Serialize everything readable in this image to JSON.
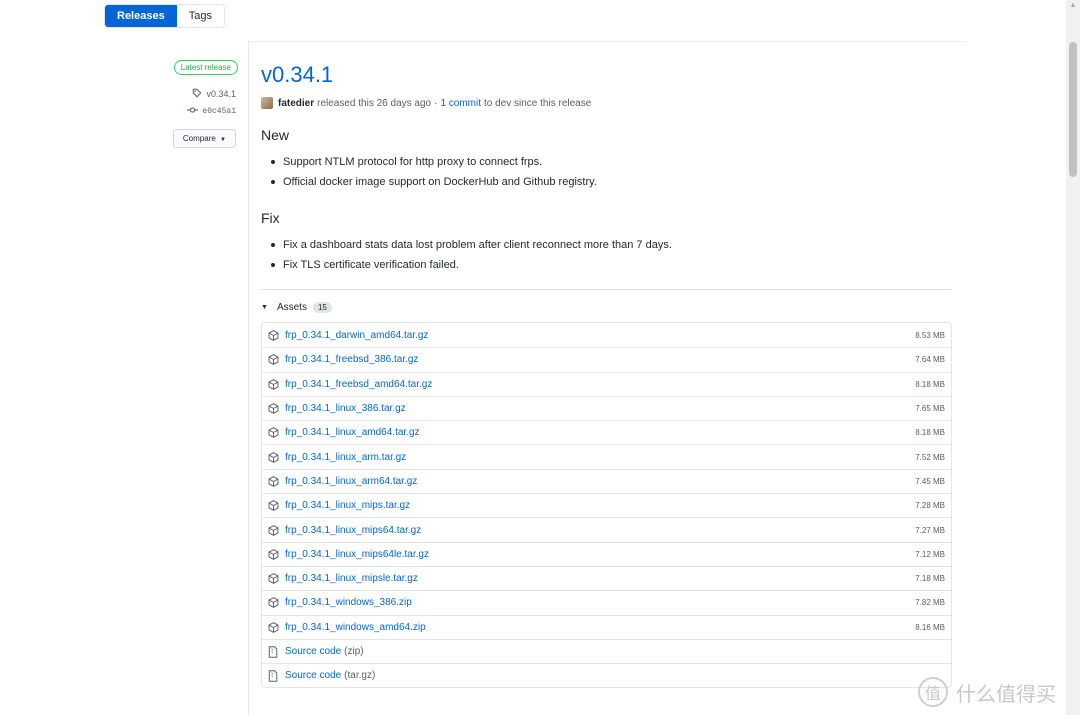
{
  "subnav": {
    "tabs": [
      {
        "label": "Releases",
        "active": true
      },
      {
        "label": "Tags",
        "active": false
      }
    ]
  },
  "meta": {
    "badge": "Latest release",
    "tag": "v0.34.1",
    "commit": "e0c45a1",
    "compare": "Compare"
  },
  "release": {
    "title": "v0.34.1",
    "author": "fatedier",
    "released_text": "released this 26 days ago",
    "separator": "·",
    "commits_link": "1 commit",
    "commits_suffix": "to dev since this release"
  },
  "sections": [
    {
      "heading": "New",
      "items": [
        "Support NTLM protocol for http proxy to connect frps.",
        "Official docker image support on DockerHub and Github registry."
      ]
    },
    {
      "heading": "Fix",
      "items": [
        "Fix a dashboard stats data lost problem after client reconnect more than 7 days.",
        "Fix TLS certificate verification failed."
      ]
    }
  ],
  "assets": {
    "label": "Assets",
    "count": "15",
    "files": [
      {
        "name": "frp_0.34.1_darwin_amd64.tar.gz",
        "size": "8.53 MB"
      },
      {
        "name": "frp_0.34.1_freebsd_386.tar.gz",
        "size": "7.64 MB"
      },
      {
        "name": "frp_0.34.1_freebsd_amd64.tar.gz",
        "size": "8.18 MB"
      },
      {
        "name": "frp_0.34.1_linux_386.tar.gz",
        "size": "7.65 MB"
      },
      {
        "name": "frp_0.34.1_linux_amd64.tar.gz",
        "size": "8.18 MB",
        "highlighted": true
      },
      {
        "name": "frp_0.34.1_linux_arm.tar.gz",
        "size": "7.52 MB"
      },
      {
        "name": "frp_0.34.1_linux_arm64.tar.gz",
        "size": "7.45 MB"
      },
      {
        "name": "frp_0.34.1_linux_mips.tar.gz",
        "size": "7.28 MB"
      },
      {
        "name": "frp_0.34.1_linux_mips64.tar.gz",
        "size": "7.27 MB"
      },
      {
        "name": "frp_0.34.1_linux_mips64le.tar.gz",
        "size": "7.12 MB"
      },
      {
        "name": "frp_0.34.1_linux_mipsle.tar.gz",
        "size": "7.18 MB"
      },
      {
        "name": "frp_0.34.1_windows_386.zip",
        "size": "7.82 MB"
      },
      {
        "name": "frp_0.34.1_windows_amd64.zip",
        "size": "8.16 MB"
      }
    ],
    "source": [
      {
        "label": "Source code",
        "suffix": "(zip)"
      },
      {
        "label": "Source code",
        "suffix": "(tar.gz)"
      }
    ]
  },
  "watermark": {
    "icon_text": "值",
    "text": "什么值得买"
  },
  "colors": {
    "link": "#0366d6",
    "accent": "#0366d6",
    "badge": "#28a745",
    "highlight": "#e0292c"
  },
  "icons": {
    "tag": "tag-icon",
    "commit": "commit-icon",
    "package": "package-icon",
    "file_zip": "file-zip-icon",
    "caret": "caret-down-icon"
  }
}
